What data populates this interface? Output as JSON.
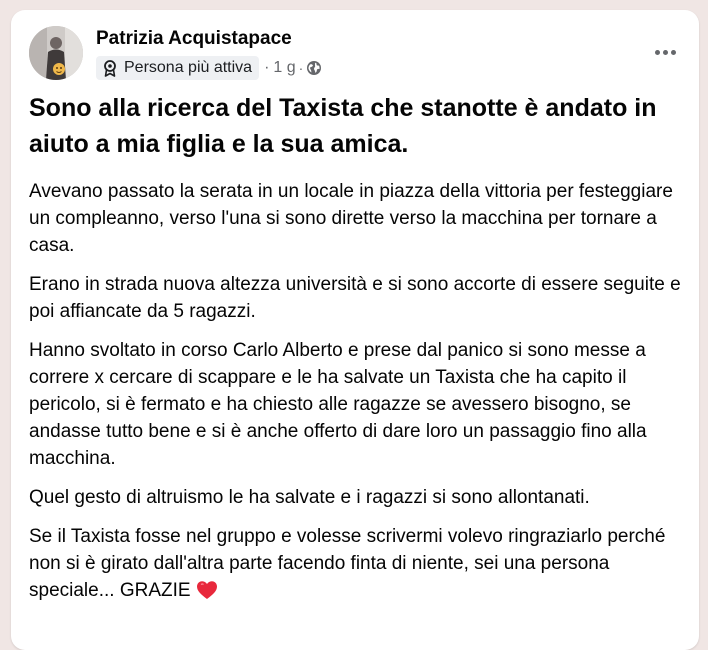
{
  "post": {
    "author": "Patrizia Acquistapace",
    "badge_icon": "top-fan-badge-icon",
    "badge_label": "Persona più attiva",
    "separator": "·",
    "time": "1 g",
    "separator2": "·",
    "privacy_icon": "globe-icon",
    "more_icon": "more-options-icon",
    "title": "Sono alla ricerca del Taxista che stanotte è andato in aiuto a mia figlia e la sua amica.",
    "paragraphs": [
      "Avevano passato la serata in un locale in piazza della vittoria per festeggiare un compleanno, verso l'una si sono dirette verso la macchina per tornare a casa.",
      "Erano in strada nuova altezza università e si sono accorte di essere seguite e poi affiancate da 5 ragazzi.",
      "Hanno svoltato in corso Carlo Alberto e prese dal panico si sono messe a correre x cercare di scappare e le ha salvate un Taxista che ha capito il pericolo, si è fermato e ha chiesto alle ragazze se avessero bisogno, se andasse tutto bene e si è anche offerto di dare loro un passaggio fino alla macchina.",
      "Quel gesto di altruismo le ha salvate e i ragazzi si sono allontanati.",
      "Se il Taxista fosse nel gruppo e volesse scrivermi volevo ringraziarlo perché non si è girato dall'altra parte facendo finta di niente, sei una persona speciale... GRAZIE"
    ],
    "end_emoji": "heart-icon"
  },
  "colors": {
    "page_background": "#f0e6e4",
    "card": "#ffffff",
    "text": "#050505",
    "secondary_text": "#65676b",
    "badge_background": "#eef0f3",
    "heart": "#e8283c"
  }
}
